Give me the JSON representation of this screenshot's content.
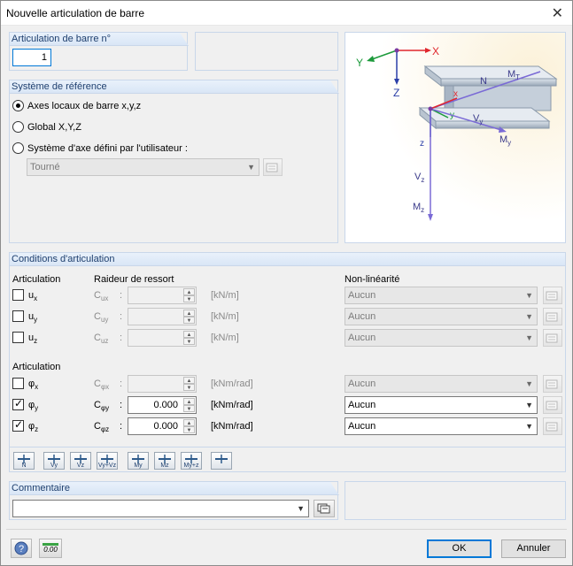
{
  "window": {
    "title": "Nouvelle articulation de barre",
    "close_symbol": "✕"
  },
  "hinge_no": {
    "label": "Articulation de barre n°",
    "value": "1"
  },
  "reference": {
    "header": "Système de référence",
    "options": [
      {
        "label": "Axes locaux de barre x,y,z",
        "selected": true
      },
      {
        "label": "Global X,Y,Z",
        "selected": false
      },
      {
        "label": "Système d'axe défini par l'utilisateur :",
        "selected": false
      }
    ],
    "user_axis_value": "Tourné"
  },
  "diagram": {
    "labels": {
      "X": "X",
      "Y": "Y",
      "Z": "Z",
      "N": "N",
      "MT": "M",
      "MT_sub": "T",
      "x": "x",
      "y": "y",
      "z": "z",
      "Vy": "V",
      "Vy_sub": "y",
      "My": "M",
      "My_sub": "y",
      "Vz": "V",
      "Vz_sub": "z",
      "Mz": "M",
      "Mz_sub": "z"
    }
  },
  "conditions": {
    "header": "Conditions d'articulation",
    "col_articulation": "Articulation",
    "col_spring": "Raideur de ressort",
    "col_nonlinear": "Non-linéarité",
    "subheader_rot": "Articulation",
    "rows": [
      {
        "sym": "u",
        "sub": "x",
        "checked": false,
        "spring_label": "C",
        "spring_sub": "ux",
        "value": "",
        "unit": "[kN/m]",
        "nonlinear": "Aucun",
        "active": false
      },
      {
        "sym": "u",
        "sub": "y",
        "checked": false,
        "spring_label": "C",
        "spring_sub": "uy",
        "value": "",
        "unit": "[kN/m]",
        "nonlinear": "Aucun",
        "active": false
      },
      {
        "sym": "u",
        "sub": "z",
        "checked": false,
        "spring_label": "C",
        "spring_sub": "uz",
        "value": "",
        "unit": "[kN/m]",
        "nonlinear": "Aucun",
        "active": false
      },
      {
        "sym": "φ",
        "sub": "x",
        "checked": false,
        "spring_label": "C",
        "spring_sub": "φx",
        "value": "",
        "unit": "[kNm/rad]",
        "nonlinear": "Aucun",
        "active": false
      },
      {
        "sym": "φ",
        "sub": "y",
        "checked": true,
        "spring_label": "C",
        "spring_sub": "φy",
        "value": "0.000",
        "unit": "[kNm/rad]",
        "nonlinear": "Aucun",
        "active": true
      },
      {
        "sym": "φ",
        "sub": "z",
        "checked": true,
        "spring_label": "C",
        "spring_sub": "φz",
        "value": "0.000",
        "unit": "[kNm/rad]",
        "nonlinear": "Aucun",
        "active": true
      }
    ],
    "colon": ":"
  },
  "toolbar": {
    "buttons": [
      {
        "name": "n-release-button",
        "label": "N"
      },
      {
        "name": "vy-release-button",
        "label": "Vy"
      },
      {
        "name": "vz-release-button",
        "label": "Vz"
      },
      {
        "name": "vyvz-release-button",
        "label": "Vy+Vz"
      },
      {
        "name": "my-release-button",
        "label": "My"
      },
      {
        "name": "mz-release-button",
        "label": "Mz"
      },
      {
        "name": "mymz-release-button",
        "label": "My+z"
      },
      {
        "name": "reset-release-button",
        "label": ""
      }
    ]
  },
  "comment": {
    "header": "Commentaire",
    "value": ""
  },
  "footer": {
    "ok": "OK",
    "cancel": "Annuler",
    "units_icon_text": "0.00"
  },
  "colors": {
    "accent": "#0078d7",
    "header_text": "#1e3f6e",
    "axis_red": "#e0262d",
    "axis_green": "#1c9a3b",
    "axis_blue": "#2a3ea8",
    "force_purple": "#7a6ad6"
  }
}
